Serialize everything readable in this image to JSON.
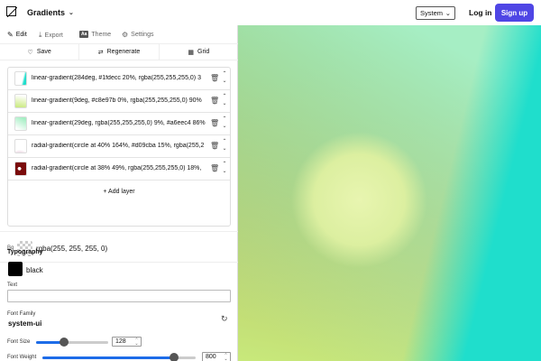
{
  "header": {
    "brand": "Gradients",
    "theme_select": "System",
    "login": "Log in",
    "signup": "Sign up"
  },
  "tabs": [
    {
      "label": "Edit",
      "icon": "edit-icon"
    },
    {
      "label": "Export",
      "icon": "download-icon"
    },
    {
      "label": "Theme",
      "icon": "theme-icon",
      "badge": "Aa"
    },
    {
      "label": "Settings",
      "icon": "gear-icon"
    }
  ],
  "toolbar": {
    "save": "Save",
    "regenerate": "Regenerate",
    "grid": "Grid"
  },
  "layers": [
    {
      "text": "linear-gradient(284deg, #1fdecc 20%, rgba(255,255,255,0) 3",
      "swatch": "linear-gradient(284deg, #1fdecc 20%, rgba(255,255,255,0) 35%)"
    },
    {
      "text": "linear-gradient(9deg, #c8e97b 0%, rgba(255,255,255,0) 90%",
      "swatch": "linear-gradient(9deg, #c8e97b 0%, rgba(255,255,255,0) 90%)"
    },
    {
      "text": "linear-gradient(29deg, rgba(255,255,255,0) 9%, #a6eec4 86%",
      "swatch": "linear-gradient(29deg, rgba(255,255,255,0) 9%, #a6eec4 86%)"
    },
    {
      "text": "radial-gradient(circle at 40% 164%, #d09cba 15%, rgba(255,2",
      "swatch": "radial-gradient(circle at 40% 164%, #d09cba 15%, rgba(255,255,255,0) 50%)"
    },
    {
      "text": "radial-gradient(circle at 38% 49%, rgba(255,255,255,0) 18%,",
      "swatch": "radial-gradient(circle at 38% 49%, #fff 18%, #7a0b0b 19%)"
    }
  ],
  "add_layer": "+ Add layer",
  "bg": {
    "label": "Bg",
    "value": "rgba(255, 255, 255, 0)"
  },
  "typography": {
    "title": "Typography",
    "color_name": "black",
    "text_label": "Text",
    "text_value": "",
    "font_family_label": "Font Family",
    "font_family": "system-ui",
    "font_size_label": "Font Size",
    "font_size": "128",
    "font_size_fraction": 0.39,
    "font_weight_label": "Font Weight",
    "font_weight": "800",
    "font_weight_fraction": 0.86
  },
  "colors": {
    "accent": "#4f46e5",
    "teal": "#1fdecc",
    "lime": "#c8e97b",
    "mint": "#a6eec4",
    "pink": "#d09cba"
  }
}
